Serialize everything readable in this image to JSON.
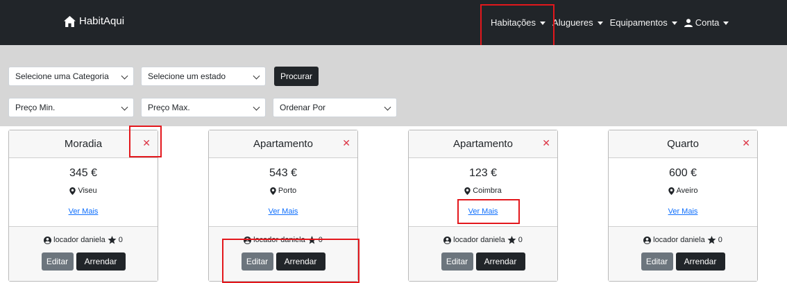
{
  "navbar": {
    "brand": "HabitAqui",
    "items": [
      {
        "label": "Habitações",
        "icon": "caret-down-icon"
      },
      {
        "label": "Alugueres",
        "icon": "caret-down-icon"
      },
      {
        "label": "Equipamentos",
        "icon": "caret-down-icon"
      },
      {
        "label": "Conta",
        "icon": "user-icon"
      }
    ]
  },
  "filters": {
    "category": "Selecione uma Categoria",
    "state": "Selecione um estado",
    "search_label": "Procurar",
    "price_min": "Preço Min.",
    "price_max": "Preço Max.",
    "order_by": "Ordenar Por"
  },
  "cards": [
    {
      "title": "Moradia",
      "price": "345 €",
      "location": "Viseu",
      "more": "Ver Mais",
      "owner": "locador daniela",
      "rating": "0",
      "edit": "Editar",
      "rent": "Arrendar"
    },
    {
      "title": "Apartamento",
      "price": "543 €",
      "location": "Porto",
      "more": "Ver Mais",
      "owner": "locador daniela",
      "rating": "0",
      "edit": "Editar",
      "rent": "Arrendar"
    },
    {
      "title": "Apartamento",
      "price": "123 €",
      "location": "Coimbra",
      "more": "Ver Mais",
      "owner": "locador daniela",
      "rating": "0",
      "edit": "Editar",
      "rent": "Arrendar"
    },
    {
      "title": "Quarto",
      "price": "600 €",
      "location": "Aveiro",
      "more": "Ver Mais",
      "owner": "locador daniela",
      "rating": "0",
      "edit": "Editar",
      "rent": "Arrendar"
    }
  ],
  "colors": {
    "navbar_bg": "#212529",
    "filter_bg": "#d6d6d6",
    "link": "#0d6efd",
    "close": "#dc3545",
    "highlight": "#e3171c"
  }
}
